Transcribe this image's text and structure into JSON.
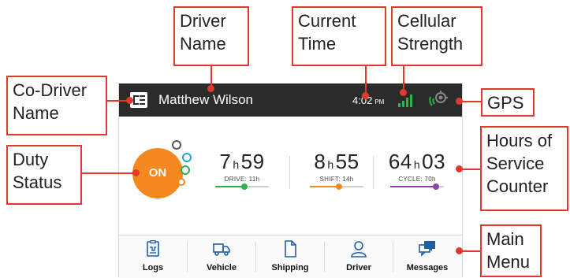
{
  "header": {
    "driver_name": "Matthew Wilson",
    "time": "4:02",
    "ampm": "PM"
  },
  "duty_status": {
    "label": "ON",
    "color": "#f5891f"
  },
  "counters": [
    {
      "hours": "7",
      "minutes": "59",
      "label": "DRIVE: 11h",
      "color": "#2db34a",
      "progress": 0.55
    },
    {
      "hours": "8",
      "minutes": "55",
      "label": "SHIFT: 14h",
      "color": "#f5891f",
      "progress": 0.55
    },
    {
      "hours": "64",
      "minutes": "03",
      "label": "CYCLE: 70h",
      "color": "#8e44ad",
      "progress": 0.85
    }
  ],
  "hour_unit": "h",
  "menu": [
    {
      "label": "Logs",
      "icon": "logs-icon"
    },
    {
      "label": "Vehicle",
      "icon": "truck-icon"
    },
    {
      "label": "Shipping",
      "icon": "document-icon"
    },
    {
      "label": "Driver",
      "icon": "person-icon"
    },
    {
      "label": "Messages",
      "icon": "messages-icon"
    }
  ],
  "callouts": {
    "driver_name": "Driver\nName",
    "current_time": "Current\nTime",
    "cellular": "Cellular\nStrength",
    "co_driver": "Co-Driver\nName",
    "gps": "GPS",
    "duty_status": "Duty\nStatus",
    "hos": "Hours of\nService\nCounter",
    "main_menu": "Main\nMenu"
  },
  "colors": {
    "accent": "#e03a2f",
    "topbar": "#2b2b2b",
    "signal": "#2db34a"
  }
}
